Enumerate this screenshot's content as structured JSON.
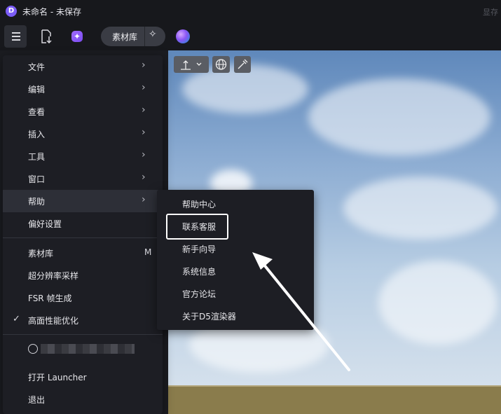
{
  "window": {
    "title": "未命名 - 未保存",
    "memory_label": "显存",
    "logo_letter": "D"
  },
  "toolbar": {
    "menu_icon": "hamburger-icon",
    "import_icon": "file-import-icon",
    "ai_icon": "ai-sparkle-icon",
    "asset_library_label": "素材库",
    "asset_sparkle_icon": "sparkle-icon",
    "orb_icon": "ai-orb-icon"
  },
  "viewport": {
    "tools": [
      "transform-axis-icon",
      "globe-icon",
      "eyedropper-icon"
    ]
  },
  "main_menu": {
    "items": [
      {
        "label": "文件",
        "has_submenu": true
      },
      {
        "label": "编辑",
        "has_submenu": true
      },
      {
        "label": "查看",
        "has_submenu": true
      },
      {
        "label": "插入",
        "has_submenu": true
      },
      {
        "label": "工具",
        "has_submenu": true
      },
      {
        "label": "窗口",
        "has_submenu": true
      },
      {
        "label": "帮助",
        "has_submenu": true,
        "active": true
      },
      {
        "label": "偏好设置"
      }
    ],
    "section2": [
      {
        "label": "素材库",
        "shortcut": "M"
      },
      {
        "label": "超分辨率采样"
      },
      {
        "label": "FSR 帧生成"
      },
      {
        "label": "高面性能优化",
        "checked": true
      }
    ],
    "section3": [
      {
        "label": "打开 Launcher"
      },
      {
        "label": "退出"
      }
    ]
  },
  "help_submenu": {
    "items": [
      {
        "label": "帮助中心"
      },
      {
        "label": "联系客服",
        "highlighted": true
      },
      {
        "label": "新手向导"
      },
      {
        "label": "系统信息"
      },
      {
        "label": "官方论坛"
      },
      {
        "label": "关于D5渲染器"
      }
    ]
  },
  "colors": {
    "accent": "#7b5cf6",
    "menu_bg": "#1d1e24",
    "active_row": "#2d2f37"
  }
}
